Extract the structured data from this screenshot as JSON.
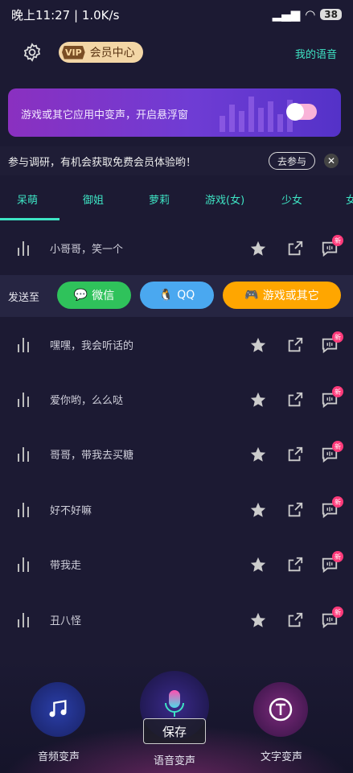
{
  "status": {
    "time": "晚上11:27 | 1.0K/s",
    "battery": "38"
  },
  "header": {
    "vip_badge": "VIP",
    "vip_label": "会员中心",
    "my_voice": "我的语音"
  },
  "banner": {
    "text": "游戏或其它应用中变声，开启悬浮窗",
    "toggle_on": false
  },
  "survey": {
    "text": "参与调研，有机会获取免费会员体验哟！",
    "join": "去参与",
    "close": "✕"
  },
  "tabs": [
    "呆萌",
    "御姐",
    "萝莉",
    "游戏(女)",
    "少女",
    "女"
  ],
  "send": {
    "label": "发送至",
    "wechat": "微信",
    "qq": "QQ",
    "game": "游戏或其它"
  },
  "rows": [
    {
      "name": "小哥哥，笑一个",
      "new": "新"
    },
    {
      "name": "嘿嘿，我会听话的",
      "new": "新"
    },
    {
      "name": "爱你哟，么么哒",
      "new": "新"
    },
    {
      "name": "哥哥，带我去买糖",
      "new": "新"
    },
    {
      "name": "好不好嘛",
      "new": "新"
    },
    {
      "name": "带我走",
      "new": "新"
    },
    {
      "name": "丑八怪",
      "new": "新"
    }
  ],
  "bottom": {
    "audio": "音频变声",
    "voice": "语音变声",
    "text": "文字变声",
    "save": "保存"
  },
  "colors": {
    "accent": "#3ee4c4",
    "wechat": "#2fc25b",
    "qq": "#4aa8f0",
    "game": "#ffa600",
    "new_badge": "#ff3a7a"
  }
}
